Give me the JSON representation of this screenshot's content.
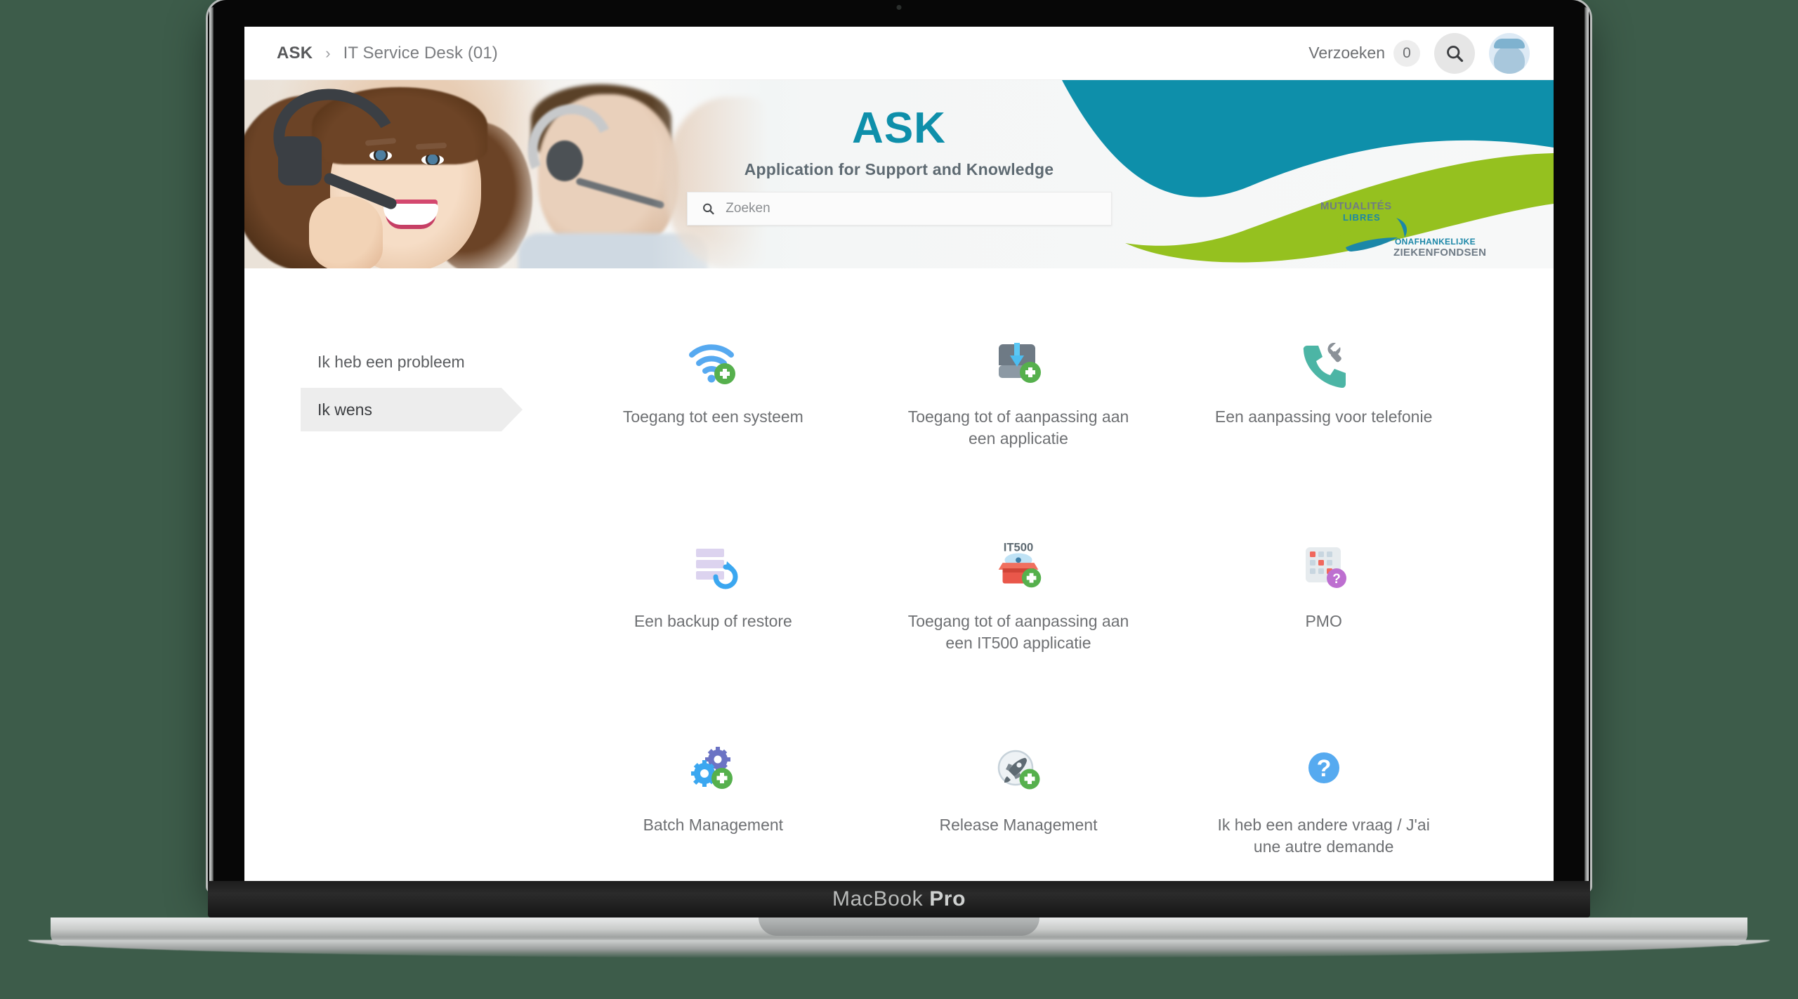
{
  "mockup": {
    "device_label_regular": "MacBook ",
    "device_label_bold": "Pro"
  },
  "topbar": {
    "breadcrumb": {
      "root": "ASK",
      "separator": "›",
      "current": "IT Service Desk (01)"
    },
    "requests_label": "Verzoeken",
    "requests_count": "0",
    "search_icon": "search-icon",
    "avatar_icon": "user-avatar-icon"
  },
  "hero": {
    "title": "ASK",
    "subtitle": "Application for Support and Knowledge",
    "search_placeholder": "Zoeken",
    "search_value": "",
    "search_icon": "search-icon",
    "logo": {
      "line1": "MUTUALITÉS",
      "line2": "LIBRES",
      "line3": "ONAFHANKELIJKE",
      "line4": "ZIEKENFONDSEN"
    },
    "photo_alt": "call-center-agents-photo"
  },
  "side_nav": {
    "items": [
      {
        "label": "Ik heb een probleem",
        "active": false
      },
      {
        "label": "Ik wens",
        "active": true
      }
    ]
  },
  "tiles": [
    {
      "label": "Toegang tot een systeem",
      "icon": "wifi-add-icon"
    },
    {
      "label": "Toegang tot of aanpassing aan een applicatie",
      "icon": "app-install-add-icon"
    },
    {
      "label": "Een aanpassing voor telefonie",
      "icon": "phone-wrench-icon"
    },
    {
      "label": "Een backup of restore",
      "icon": "database-restore-icon"
    },
    {
      "label": "Toegang tot of aanpassing aan een IT500 applicatie",
      "icon": "it500-box-add-icon"
    },
    {
      "label": "PMO",
      "icon": "calendar-question-icon"
    },
    {
      "label": "Batch Management",
      "icon": "gears-add-icon"
    },
    {
      "label": "Release Management",
      "icon": "rocket-add-icon"
    },
    {
      "label": "Ik heb een andere vraag / J'ai une autre demande",
      "icon": "question-circle-icon"
    }
  ],
  "colors": {
    "brand_teal": "#0e8faa",
    "brand_green": "#95c11f",
    "accent_blue": "#55aaf0",
    "badge_green": "#56b04d",
    "badge_purple": "#bd6fd0",
    "page_bg": "#3d5c4a",
    "nav_active_bg": "#ededed"
  },
  "it500_badge_text": "IT500"
}
